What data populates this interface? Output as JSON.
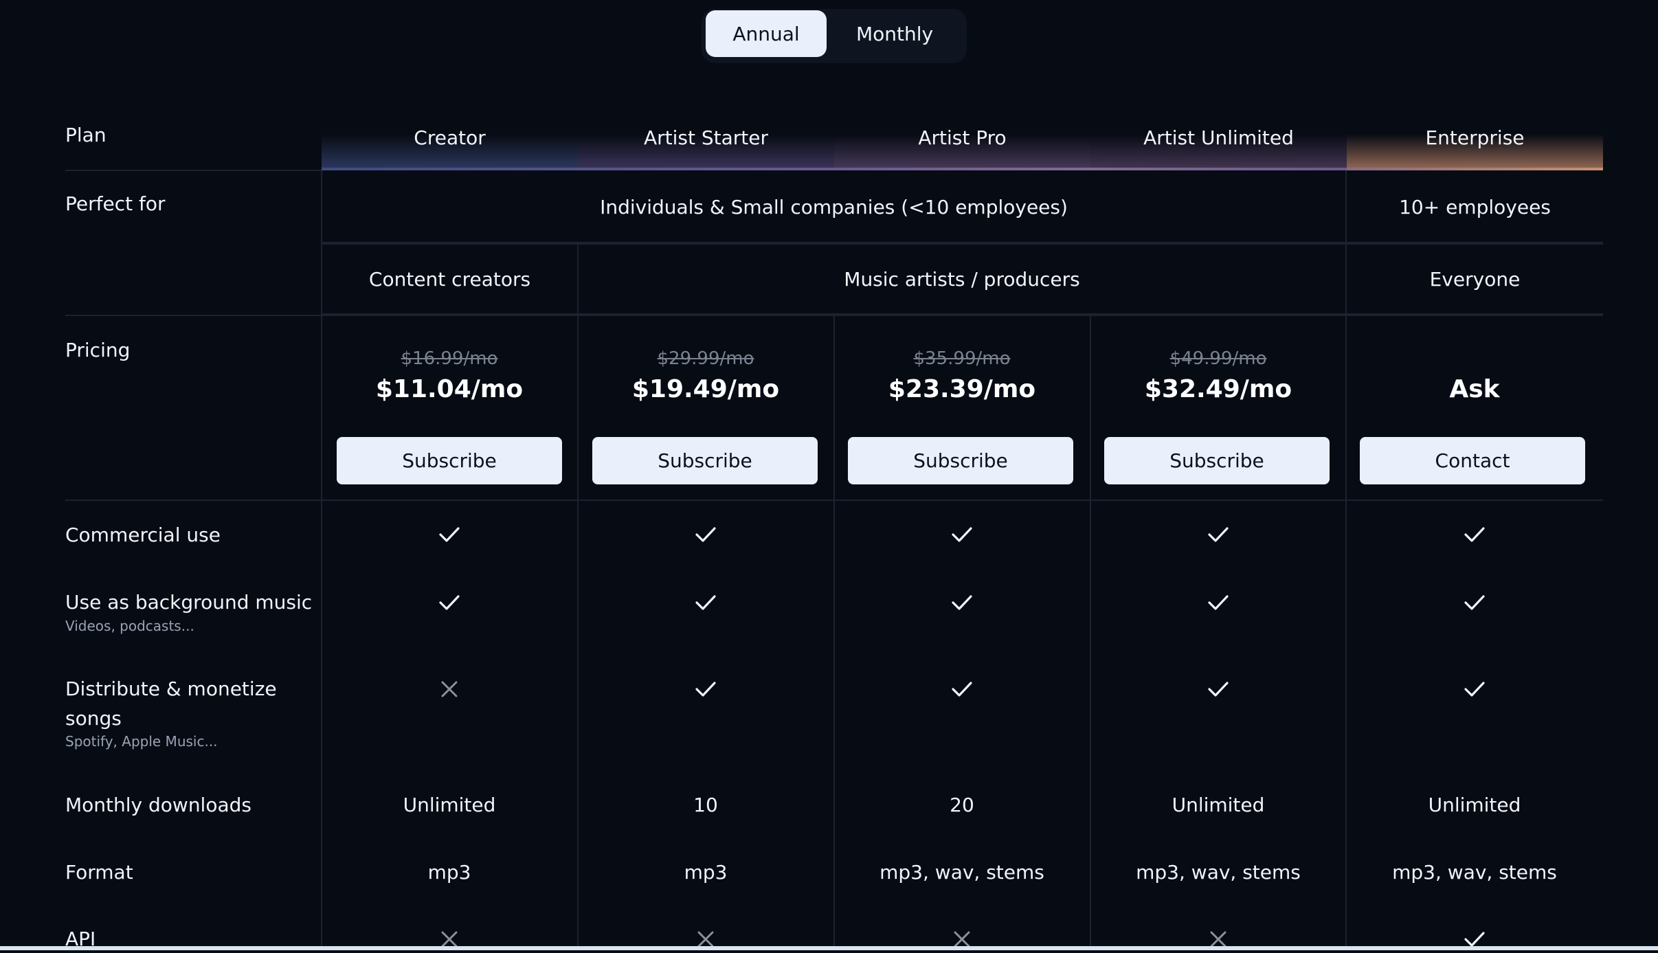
{
  "toggle": {
    "annual": "Annual",
    "monthly": "Monthly"
  },
  "plans": [
    {
      "name": "Creator",
      "old_price": "$16.99/mo",
      "price": "$11.04/mo",
      "button": "Subscribe"
    },
    {
      "name": "Artist Starter",
      "old_price": "$29.99/mo",
      "price": "$19.49/mo",
      "button": "Subscribe"
    },
    {
      "name": "Artist Pro",
      "old_price": "$35.99/mo",
      "price": "$23.39/mo",
      "button": "Subscribe"
    },
    {
      "name": "Artist Unlimited",
      "old_price": "$49.99/mo",
      "price": "$32.49/mo",
      "button": "Subscribe"
    },
    {
      "name": "Enterprise",
      "old_price": "",
      "price": "Ask",
      "button": "Contact"
    }
  ],
  "rows": {
    "plan": "Plan",
    "perfect_for": "Perfect for",
    "pricing": "Pricing",
    "commercial": "Commercial use",
    "background": "Use as background music",
    "background_sub": "Videos, podcasts...",
    "distribute_l1": "Distribute & monetize",
    "distribute_l2": "songs",
    "distribute_sub": "Spotify, Apple Music...",
    "downloads": "Monthly downloads",
    "format": "Format",
    "api": "API"
  },
  "perfect_for": {
    "individuals": "Individuals & Small companies (<10 employees)",
    "enterprise": "10+ employees",
    "creators": "Content creators",
    "artists": "Music artists / producers",
    "everyone": "Everyone"
  },
  "features": {
    "commercial": [
      "check-icon",
      "check-icon",
      "check-icon",
      "check-icon",
      "check-icon"
    ],
    "background": [
      "check-icon",
      "check-icon",
      "check-icon",
      "check-icon",
      "check-icon"
    ],
    "distribute": [
      "cross-icon",
      "check-icon",
      "check-icon",
      "check-icon",
      "check-icon"
    ],
    "api": [
      "cross-icon",
      "cross-icon",
      "cross-icon",
      "cross-icon",
      "check-icon"
    ]
  },
  "downloads": [
    "Unlimited",
    "10",
    "20",
    "Unlimited",
    "Unlimited"
  ],
  "format": [
    "mp3",
    "mp3",
    "mp3, wav, stems",
    "mp3, wav, stems",
    "mp3, wav, stems"
  ],
  "colors": {
    "background": "#070b14",
    "button": "#e9f0fb",
    "line": "#1b2330",
    "muted": "#7a828f"
  }
}
